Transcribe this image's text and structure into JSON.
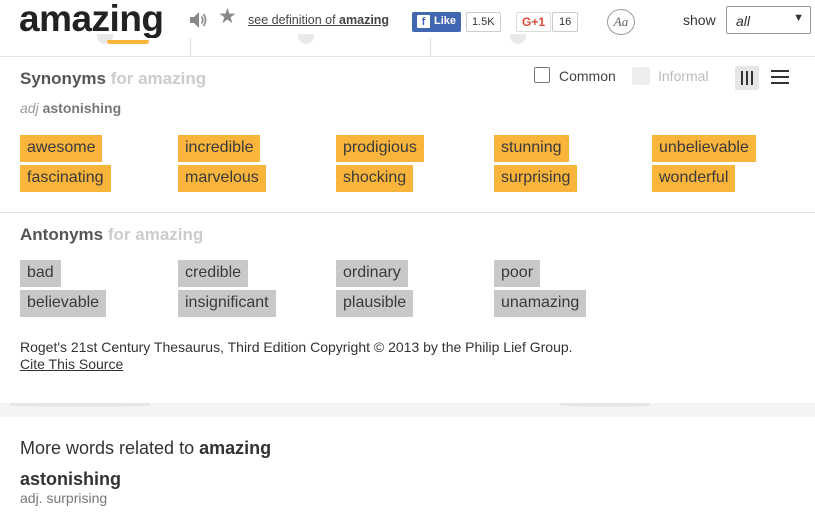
{
  "header": {
    "word": "amazing",
    "see_definition_prefix": "see definition of ",
    "see_definition_word": "amazing",
    "fb_like_label": "Like",
    "fb_count": "1.5K",
    "gplus_label": "G+1",
    "gplus_count": "16",
    "font_icon_label": "Aa",
    "show_label": "show",
    "show_selected": "all"
  },
  "synonyms": {
    "title": "Synonyms",
    "subtitle": "for amazing",
    "pos": "adj",
    "sense": "astonishing",
    "filter_common": "Common",
    "filter_informal": "Informal",
    "words": [
      "awesome",
      "incredible",
      "prodigious",
      "stunning",
      "unbelievable",
      "fascinating",
      "marvelous",
      "shocking",
      "surprising",
      "wonderful"
    ]
  },
  "antonyms": {
    "title": "Antonyms",
    "subtitle": "for amazing",
    "words": [
      "bad",
      "credible",
      "ordinary",
      "poor",
      "believable",
      "insignificant",
      "plausible",
      "unamazing"
    ]
  },
  "source": {
    "copyright": "Roget's 21st Century Thesaurus, Third Edition Copyright © 2013 by the Philip Lief Group.",
    "cite_label": "Cite This Source"
  },
  "related": {
    "title_prefix": "More words related to ",
    "title_word": "amazing",
    "items": [
      {
        "word": "astonishing",
        "definition": "adj. surprising"
      }
    ]
  },
  "colors": {
    "synonym_chip": "#f9b43c",
    "antonym_chip": "#c8c8c8",
    "facebook": "#4267b2",
    "gplus": "#dd4b39"
  }
}
